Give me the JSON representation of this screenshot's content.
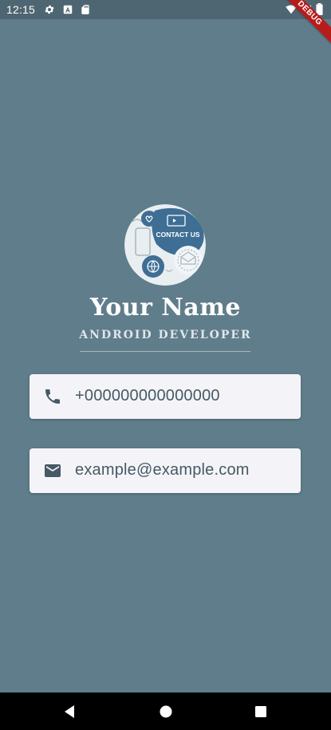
{
  "status_bar": {
    "time": "12:15",
    "left_icons": [
      "gear-icon",
      "a-notification-icon",
      "sd-card-icon"
    ],
    "right_icons": [
      "wifi-icon",
      "signal-icon",
      "battery-icon"
    ]
  },
  "debug_banner": {
    "label": "DEBUG",
    "color": "#b71c1c"
  },
  "profile": {
    "avatar_text": "CONTACT US",
    "name": "Your Name",
    "role": "ANDROID DEVELOPER"
  },
  "contacts": {
    "phone": {
      "icon": "phone-icon",
      "value": "+000000000000000"
    },
    "email": {
      "icon": "mail-icon",
      "value": "example@example.com"
    }
  },
  "nav_bar": {
    "buttons": [
      "back-icon",
      "home-icon",
      "recents-icon"
    ]
  },
  "colors": {
    "background": "#607d8b",
    "card": "#f4f4f8",
    "card_text": "#455a64",
    "accent": "#4e7aa0"
  }
}
